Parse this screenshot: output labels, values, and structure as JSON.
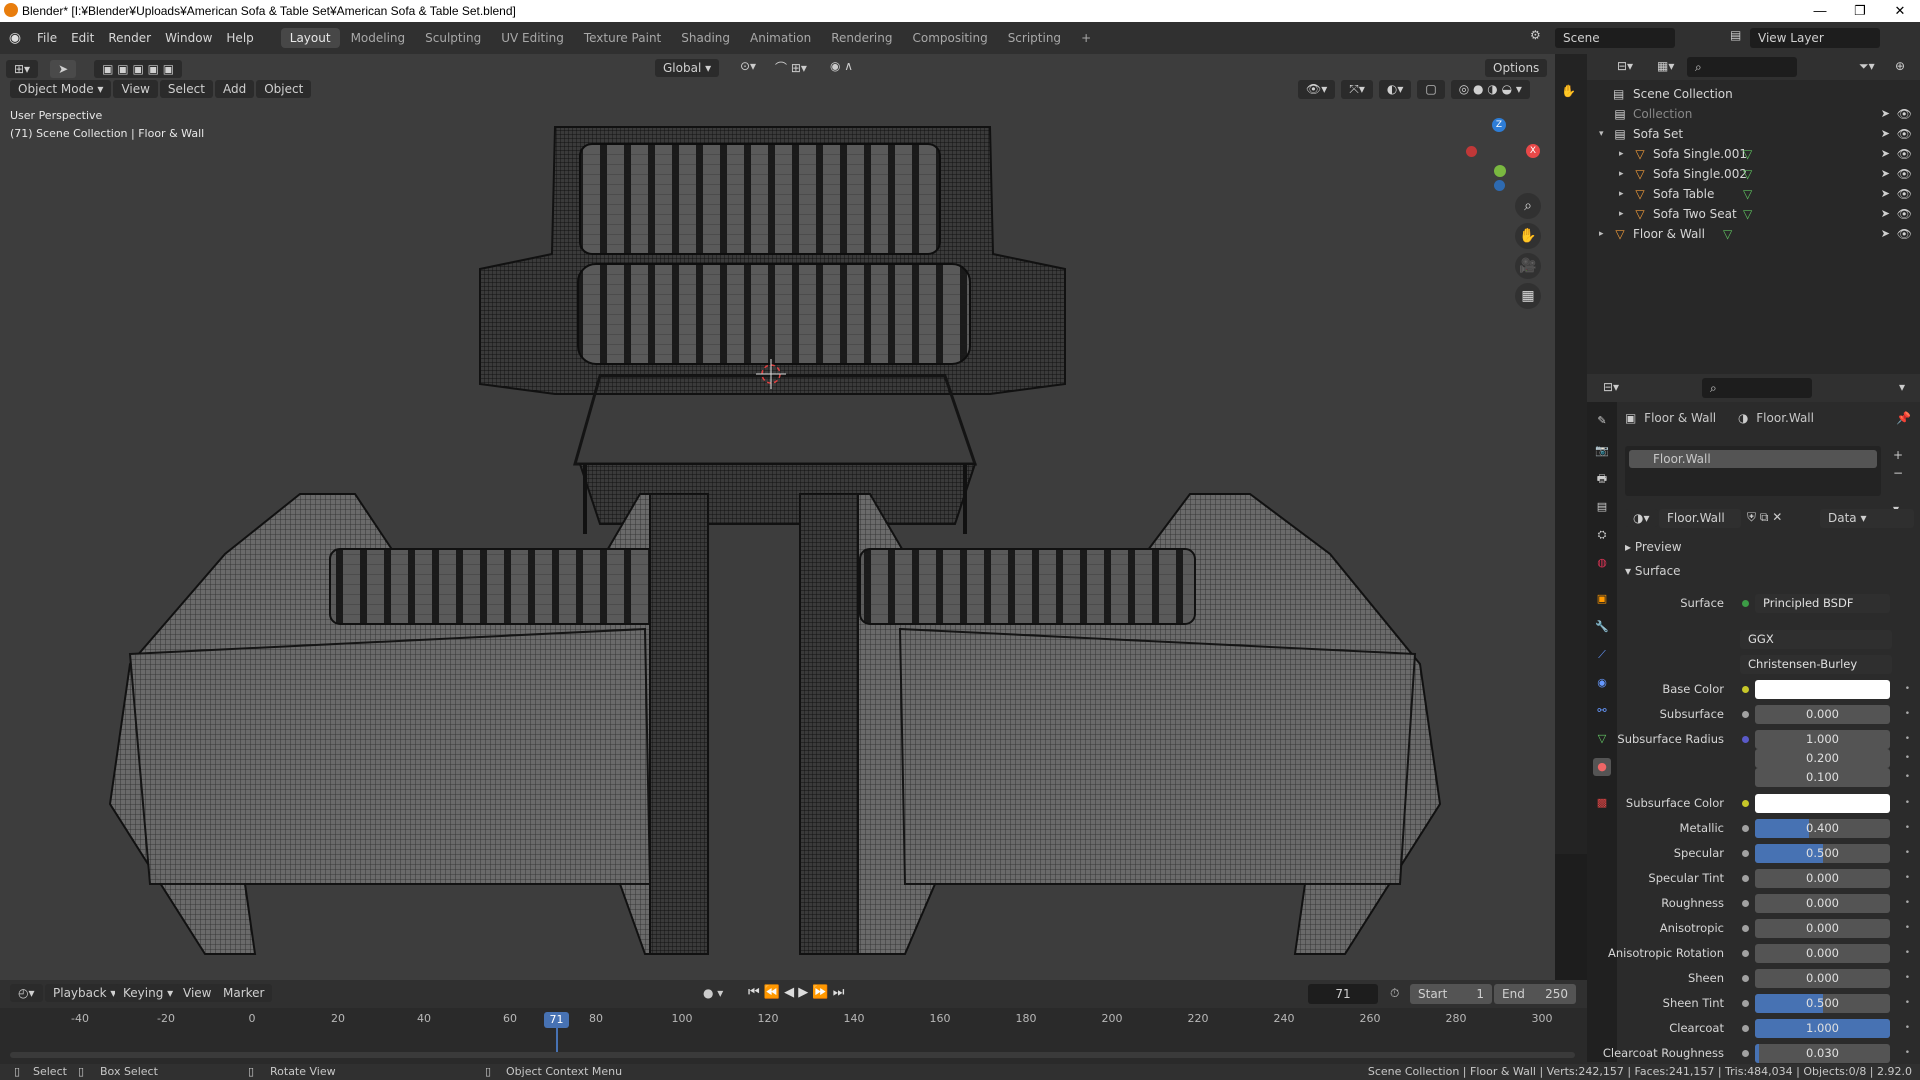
{
  "window": {
    "title": "Blender* [I:¥Blender¥Uploads¥American Sofa & Table Set¥American Sofa & Table Set.blend]",
    "minimize": "—",
    "maximize": "❐",
    "close": "✕"
  },
  "menubar": {
    "items": [
      "File",
      "Edit",
      "Render",
      "Window",
      "Help"
    ]
  },
  "workspaces": {
    "tabs": [
      "Layout",
      "Modeling",
      "Sculpting",
      "UV Editing",
      "Texture Paint",
      "Shading",
      "Animation",
      "Rendering",
      "Compositing",
      "Scripting"
    ],
    "active": "Layout",
    "add": "+"
  },
  "scene": {
    "name": "Scene",
    "view_layer": "View Layer"
  },
  "viewport_header": {
    "mode": "Object Mode",
    "menus": [
      "View",
      "Select",
      "Add",
      "Object"
    ],
    "transform_orientation": "Global",
    "options": "Options"
  },
  "viewport": {
    "perspective": "User Perspective",
    "collection_info": "(71) Scene Collection | Floor & Wall",
    "gizmo": {
      "z": "Z",
      "x": "X"
    }
  },
  "outliner": {
    "root": "Scene Collection",
    "rows": [
      {
        "label": "Collection",
        "level": 1,
        "type": "collection",
        "dim": true
      },
      {
        "label": "Sofa Set",
        "level": 1,
        "type": "collection",
        "expanded": true
      },
      {
        "label": "Sofa Single.001",
        "level": 2,
        "type": "object"
      },
      {
        "label": "Sofa Single.002",
        "level": 2,
        "type": "object"
      },
      {
        "label": "Sofa Table",
        "level": 2,
        "type": "object"
      },
      {
        "label": "Sofa Two Seat",
        "level": 2,
        "type": "object"
      },
      {
        "label": "Floor & Wall",
        "level": 1,
        "type": "object"
      }
    ]
  },
  "properties": {
    "breadcrumb_object": "Floor & Wall",
    "breadcrumb_material": "Floor.Wall",
    "slot": "Floor.Wall",
    "material_name": "Floor.Wall",
    "link": "Data",
    "panels": {
      "preview": "Preview",
      "surface": "Surface"
    },
    "surface_label": "Surface",
    "surface_shader": "Principled BSDF",
    "distribution": "GGX",
    "subsurface_method": "Christensen-Burley",
    "fields": [
      {
        "label": "Base Color",
        "value": "",
        "type": "color",
        "color": "#ffffff"
      },
      {
        "label": "Subsurface",
        "value": "0.000",
        "fill": 0
      },
      {
        "label": "Subsurface Radius",
        "value": "1.000",
        "fill": 0,
        "dot": "#5a5ac8"
      },
      {
        "label": "",
        "value": "0.200",
        "fill": 0,
        "nodot": true
      },
      {
        "label": "",
        "value": "0.100",
        "fill": 0,
        "nodot": true
      },
      {
        "label": "Subsurface Color",
        "value": "",
        "type": "color",
        "color": "#ffffff"
      },
      {
        "label": "Metallic",
        "value": "0.400",
        "fill": 0.4
      },
      {
        "label": "Specular",
        "value": "0.500",
        "fill": 0.5
      },
      {
        "label": "Specular Tint",
        "value": "0.000",
        "fill": 0
      },
      {
        "label": "Roughness",
        "value": "0.000",
        "fill": 0
      },
      {
        "label": "Anisotropic",
        "value": "0.000",
        "fill": 0
      },
      {
        "label": "Anisotropic Rotation",
        "value": "0.000",
        "fill": 0
      },
      {
        "label": "Sheen",
        "value": "0.000",
        "fill": 0
      },
      {
        "label": "Sheen Tint",
        "value": "0.500",
        "fill": 0.5
      },
      {
        "label": "Clearcoat",
        "value": "1.000",
        "fill": 1
      },
      {
        "label": "Clearcoat Roughness",
        "value": "0.030",
        "fill": 0.03
      }
    ]
  },
  "timeline": {
    "menus": [
      "Playback",
      "Keying",
      "View",
      "Marker"
    ],
    "current_frame": "71",
    "start_label": "Start",
    "start": "1",
    "end_label": "End",
    "end": "250",
    "ticks": [
      "-40",
      "-20",
      "0",
      "20",
      "40",
      "60",
      "80",
      "100",
      "120",
      "140",
      "160",
      "180",
      "200",
      "220",
      "240",
      "260",
      "280",
      "300"
    ]
  },
  "statusbar": {
    "select": "Select",
    "box_select": "Box Select",
    "rotate": "Rotate View",
    "context": "Object Context Menu",
    "stats": "Scene Collection | Floor & Wall | Verts:242,157 | Faces:241,157 | Tris:484,034 | Objects:0/8 | 2.92.0"
  },
  "colors": {
    "accent": "#4772b3",
    "selection": "#334d80",
    "orange": "#e87d0d",
    "viewport_bg": "#3d3d3d"
  }
}
